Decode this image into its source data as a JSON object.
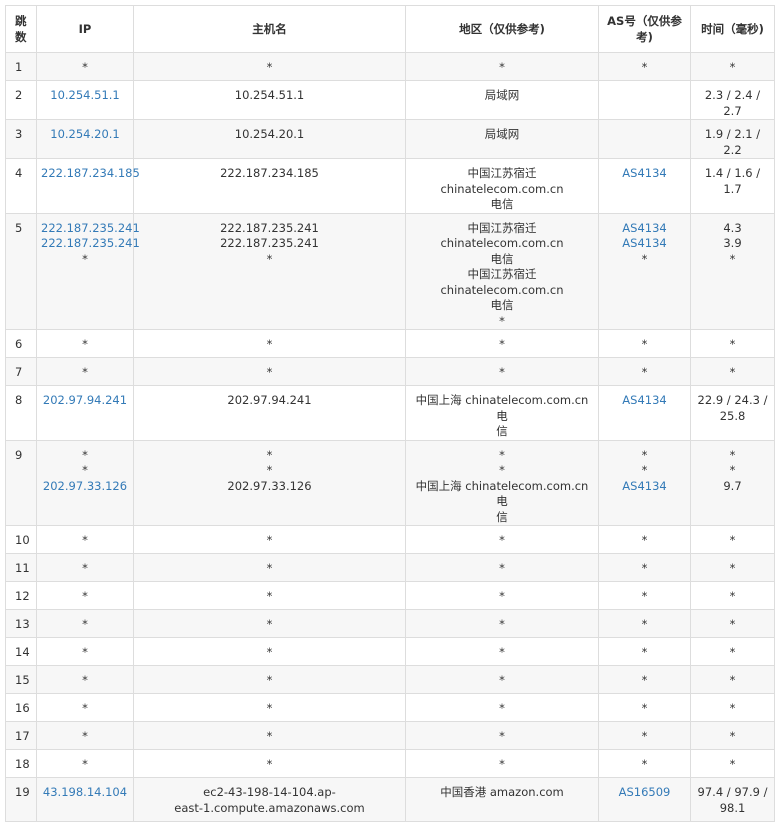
{
  "header": {
    "hop": "跳数",
    "ip": "IP",
    "host": "主机名",
    "region": "地区（仅供参考)",
    "as": "AS号（仅供参考)",
    "time": "时间（毫秒)"
  },
  "colors": {
    "link": "#337ab7",
    "border": "#dddddd",
    "stripe": "#f7f7f7"
  },
  "rows": [
    {
      "hop": "1",
      "ip": [
        "*"
      ],
      "ip_link": [
        false
      ],
      "host": [
        "*"
      ],
      "region": [
        "*"
      ],
      "as": [
        "*"
      ],
      "as_link": [
        false
      ],
      "time": [
        "*"
      ]
    },
    {
      "hop": "2",
      "ip": [
        "10.254.51.1"
      ],
      "ip_link": [
        true
      ],
      "host": [
        "10.254.51.1"
      ],
      "region": [
        "局域网"
      ],
      "as": [
        ""
      ],
      "as_link": [
        false
      ],
      "time": [
        "2.3 / 2.4 / 2.7"
      ]
    },
    {
      "hop": "3",
      "ip": [
        "10.254.20.1"
      ],
      "ip_link": [
        true
      ],
      "host": [
        "10.254.20.1"
      ],
      "region": [
        "局域网"
      ],
      "as": [
        ""
      ],
      "as_link": [
        false
      ],
      "time": [
        "1.9 / 2.1 / 2.2"
      ]
    },
    {
      "hop": "4",
      "ip": [
        "222.187.234.185"
      ],
      "ip_link": [
        true
      ],
      "host": [
        "222.187.234.185"
      ],
      "region": [
        "中国江苏宿迁 chinatelecom.com.cn",
        "电信"
      ],
      "as": [
        "AS4134"
      ],
      "as_link": [
        true
      ],
      "time": [
        "1.4 / 1.6 / 1.7"
      ]
    },
    {
      "hop": "5",
      "ip": [
        "222.187.235.241",
        "222.187.235.241",
        "*"
      ],
      "ip_link": [
        true,
        true,
        false
      ],
      "host": [
        "222.187.235.241",
        "222.187.235.241",
        "*"
      ],
      "region": [
        "中国江苏宿迁 chinatelecom.com.cn",
        "电信",
        "中国江苏宿迁 chinatelecom.com.cn",
        "电信",
        "*"
      ],
      "as": [
        "AS4134",
        "AS4134",
        "*"
      ],
      "as_link": [
        true,
        true,
        false
      ],
      "time": [
        "4.3",
        "3.9",
        "*"
      ]
    },
    {
      "hop": "6",
      "ip": [
        "*"
      ],
      "ip_link": [
        false
      ],
      "host": [
        "*"
      ],
      "region": [
        "*"
      ],
      "as": [
        "*"
      ],
      "as_link": [
        false
      ],
      "time": [
        "*"
      ]
    },
    {
      "hop": "7",
      "ip": [
        "*"
      ],
      "ip_link": [
        false
      ],
      "host": [
        "*"
      ],
      "region": [
        "*"
      ],
      "as": [
        "*"
      ],
      "as_link": [
        false
      ],
      "time": [
        "*"
      ]
    },
    {
      "hop": "8",
      "ip": [
        "202.97.94.241"
      ],
      "ip_link": [
        true
      ],
      "host": [
        "202.97.94.241"
      ],
      "region": [
        "中国上海 chinatelecom.com.cn 电",
        "信"
      ],
      "as": [
        "AS4134"
      ],
      "as_link": [
        true
      ],
      "time": [
        "22.9 / 24.3 /",
        "25.8"
      ]
    },
    {
      "hop": "9",
      "ip": [
        "*",
        "*",
        "202.97.33.126"
      ],
      "ip_link": [
        false,
        false,
        true
      ],
      "host": [
        "*",
        "*",
        "202.97.33.126"
      ],
      "region": [
        "*",
        "*",
        "中国上海 chinatelecom.com.cn 电",
        "信"
      ],
      "as": [
        "*",
        "*",
        "AS4134"
      ],
      "as_link": [
        false,
        false,
        true
      ],
      "time": [
        "*",
        "*",
        "9.7"
      ]
    },
    {
      "hop": "10",
      "ip": [
        "*"
      ],
      "ip_link": [
        false
      ],
      "host": [
        "*"
      ],
      "region": [
        "*"
      ],
      "as": [
        "*"
      ],
      "as_link": [
        false
      ],
      "time": [
        "*"
      ]
    },
    {
      "hop": "11",
      "ip": [
        "*"
      ],
      "ip_link": [
        false
      ],
      "host": [
        "*"
      ],
      "region": [
        "*"
      ],
      "as": [
        "*"
      ],
      "as_link": [
        false
      ],
      "time": [
        "*"
      ]
    },
    {
      "hop": "12",
      "ip": [
        "*"
      ],
      "ip_link": [
        false
      ],
      "host": [
        "*"
      ],
      "region": [
        "*"
      ],
      "as": [
        "*"
      ],
      "as_link": [
        false
      ],
      "time": [
        "*"
      ]
    },
    {
      "hop": "13",
      "ip": [
        "*"
      ],
      "ip_link": [
        false
      ],
      "host": [
        "*"
      ],
      "region": [
        "*"
      ],
      "as": [
        "*"
      ],
      "as_link": [
        false
      ],
      "time": [
        "*"
      ]
    },
    {
      "hop": "14",
      "ip": [
        "*"
      ],
      "ip_link": [
        false
      ],
      "host": [
        "*"
      ],
      "region": [
        "*"
      ],
      "as": [
        "*"
      ],
      "as_link": [
        false
      ],
      "time": [
        "*"
      ]
    },
    {
      "hop": "15",
      "ip": [
        "*"
      ],
      "ip_link": [
        false
      ],
      "host": [
        "*"
      ],
      "region": [
        "*"
      ],
      "as": [
        "*"
      ],
      "as_link": [
        false
      ],
      "time": [
        "*"
      ]
    },
    {
      "hop": "16",
      "ip": [
        "*"
      ],
      "ip_link": [
        false
      ],
      "host": [
        "*"
      ],
      "region": [
        "*"
      ],
      "as": [
        "*"
      ],
      "as_link": [
        false
      ],
      "time": [
        "*"
      ]
    },
    {
      "hop": "17",
      "ip": [
        "*"
      ],
      "ip_link": [
        false
      ],
      "host": [
        "*"
      ],
      "region": [
        "*"
      ],
      "as": [
        "*"
      ],
      "as_link": [
        false
      ],
      "time": [
        "*"
      ]
    },
    {
      "hop": "18",
      "ip": [
        "*"
      ],
      "ip_link": [
        false
      ],
      "host": [
        "*"
      ],
      "region": [
        "*"
      ],
      "as": [
        "*"
      ],
      "as_link": [
        false
      ],
      "time": [
        "*"
      ]
    },
    {
      "hop": "19",
      "ip": [
        "43.198.14.104"
      ],
      "ip_link": [
        true
      ],
      "host": [
        "ec2-43-198-14-104.ap-",
        "east-1.compute.amazonaws.com"
      ],
      "region": [
        "中国香港 amazon.com"
      ],
      "as": [
        "AS16509"
      ],
      "as_link": [
        true
      ],
      "time": [
        "97.4 / 97.9 /",
        "98.1"
      ]
    }
  ]
}
